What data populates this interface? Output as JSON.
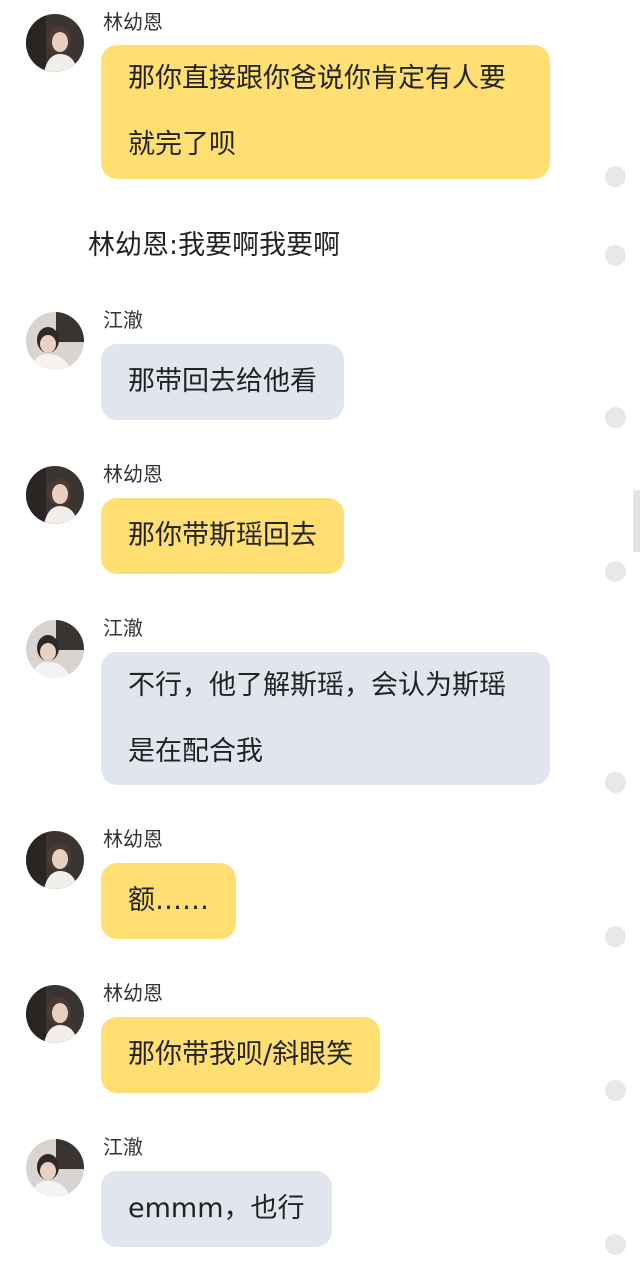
{
  "messages": [
    {
      "sender": "林幼恩",
      "text": "那你直接跟你爸说你肯定有人要就完了呗"
    },
    {
      "narration": "林幼恩:我要啊我要啊"
    },
    {
      "sender": "江澈",
      "text": "那带回去给他看"
    },
    {
      "sender": "林幼恩",
      "text": "那你带斯瑶回去"
    },
    {
      "sender": "江澈",
      "text": "不行，他了解斯瑶，会认为斯瑶是在配合我"
    },
    {
      "sender": "林幼恩",
      "text": "额……"
    },
    {
      "sender": "林幼恩",
      "text": "那你带我呗/斜眼笑"
    },
    {
      "sender": "江澈",
      "text": "emmm，也行"
    }
  ],
  "colors": {
    "lin_bubble": "#ffdf72",
    "jiang_bubble": "#e1e6ee",
    "text": "#222222",
    "sender_name": "#333333",
    "background": "#ffffff"
  },
  "icons": {
    "avatar_lin": "avatar-girl-photo",
    "avatar_jiang": "avatar-boy-photo",
    "message_status": "dot"
  }
}
